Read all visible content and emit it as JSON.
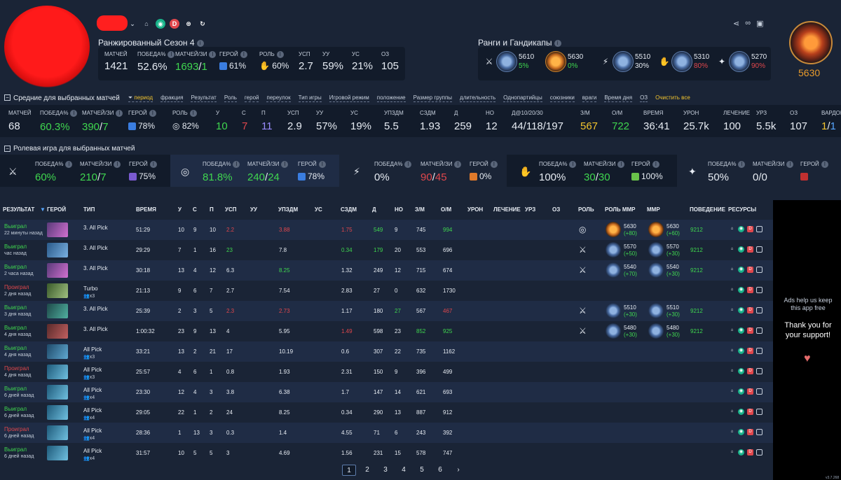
{
  "header": {
    "season_title": "Ранжированный Сезон 4",
    "ranks_title": "Ранги и Гандикапы",
    "big_mmr": "5630",
    "season_stats": [
      {
        "label": "МАТЧЕЙ",
        "value": "1421"
      },
      {
        "label": "ПОБЕДА%",
        "value": "52.6%"
      },
      {
        "label": "МАТЧЕЙ/ЗИ",
        "value_a": "1693",
        "sep": "/",
        "value_b": "1"
      },
      {
        "label": "ГЕРОЙ",
        "value": "61%"
      },
      {
        "label": "РОЛЬ",
        "value": "60%"
      },
      {
        "label": "УСП",
        "value": "2.7"
      },
      {
        "label": "УУ",
        "value": "59%"
      },
      {
        "label": "УС",
        "value": "21%"
      },
      {
        "label": "ОЗ",
        "value": "105"
      }
    ],
    "ranks": [
      {
        "mmr": "5610",
        "pct": "5%",
        "role_icon": "sword-icon",
        "color": "green"
      },
      {
        "mmr": "5630",
        "pct": "0%",
        "role_icon": "none",
        "color": "green"
      },
      {
        "mmr": "5510",
        "pct": "30%",
        "role_icon": "lightning-icon",
        "color": "white"
      },
      {
        "mmr": "5310",
        "pct": "80%",
        "role_icon": "hand-icon",
        "color": "red"
      },
      {
        "mmr": "5270",
        "pct": "90%",
        "role_icon": "support-icon",
        "color": "red"
      }
    ]
  },
  "filters": {
    "section_title": "Средние для выбранных матчей",
    "chips": [
      "период",
      "фракция",
      "Результат",
      "Роль",
      "герой",
      "переулок",
      "Тип игры",
      "Игровой режим",
      "положение",
      "Размер группы",
      "длительность",
      "Однопартийцы",
      "союзники",
      "враги",
      "Время дня",
      "ОЗ"
    ],
    "clear_label": "Очистить все"
  },
  "averages": [
    {
      "label": "МАТЧЕЙ",
      "value": "68"
    },
    {
      "label": "ПОБЕДА%",
      "value": "60.3%"
    },
    {
      "label": "МАТЧЕЙ/ЗИ",
      "value_a": "390",
      "sep": "/",
      "value_b": "7"
    },
    {
      "label": "ГЕРОЙ",
      "value": "78%"
    },
    {
      "label": "РОЛЬ",
      "value": "82%"
    },
    {
      "label": "У",
      "value": "10"
    },
    {
      "label": "С",
      "value": "7"
    },
    {
      "label": "П",
      "value": "11"
    },
    {
      "label": "УСП",
      "value": "2.9"
    },
    {
      "label": "УУ",
      "value": "57%"
    },
    {
      "label": "УС",
      "value": "19%"
    },
    {
      "label": "УПЗДМ",
      "value": "5.5"
    },
    {
      "label": "СЗДМ",
      "value": "1.93"
    },
    {
      "label": "Д",
      "value": "259"
    },
    {
      "label": "НО",
      "value": "12"
    },
    {
      "label": "Д@10/20/30",
      "value": "44/118/197"
    },
    {
      "label": "З/М",
      "value": "567"
    },
    {
      "label": "О/М",
      "value": "722"
    },
    {
      "label": "ВРЕМЯ",
      "value": "36:41"
    },
    {
      "label": "УРОН",
      "value": "25.7k"
    },
    {
      "label": "ЛЕЧЕНИЕ",
      "value": "100"
    },
    {
      "label": "УРЗ",
      "value": "5.5k"
    },
    {
      "label": "ОЗ",
      "value": "107"
    },
    {
      "label": "ВАРДОВ",
      "value_a": "1",
      "sep": "/",
      "value_b": "1"
    }
  ],
  "roles": {
    "title": "Ролевая игра для выбранных матчей",
    "cards": [
      {
        "win": "60%",
        "matches_a": "210",
        "matches_b": "7",
        "hero": "75%"
      },
      {
        "win": "81.8%",
        "matches_a": "240",
        "matches_b": "24",
        "hero": "78%"
      },
      {
        "win": "0%",
        "matches_a": "90",
        "matches_b": "45",
        "hero": "0%"
      },
      {
        "win": "100%",
        "matches_a": "30",
        "matches_b": "30",
        "hero": "100%"
      },
      {
        "win": "50%",
        "matches_a": "0",
        "matches_b": "0",
        "hero": ""
      }
    ],
    "labels": {
      "win": "ПОБЕДА%",
      "matches": "МАТЧЕЙ/ЗИ",
      "hero": "ГЕРОЙ"
    }
  },
  "table": {
    "headers": [
      "РЕЗУЛЬТАТ",
      "ГЕРОЙ",
      "ТИП",
      "ВРЕМЯ",
      "У",
      "С",
      "П",
      "УСП",
      "УУ",
      "УПЗДМ",
      "УС",
      "СЗДМ",
      "Д",
      "НО",
      "З/М",
      "О/М",
      "УРОН",
      "ЛЕЧЕНИЕ",
      "УРЗ",
      "ОЗ",
      "РОЛЬ",
      "РОЛЬ ММР",
      "ММР",
      "ПОВЕДЕНИЕ",
      "РЕСУРСЫ"
    ],
    "rows": [
      {
        "result": "Выиграл",
        "when": "22 минуты назад",
        "type": "3. All Pick",
        "party": "",
        "time": "51:29",
        "k": "10",
        "d": "9",
        "a": "10",
        "kda": "2.2",
        "upzdm": "3.88",
        "szdm": "1.75",
        "lh": "549",
        "dn": "9",
        "gpm": "745",
        "xpm": "994",
        "role": "target",
        "rmmr": "5630",
        "rdelta": "+80",
        "mmr": "5630",
        "mdelta": "+60",
        "behav": "9212",
        "win": true,
        "kda_red": true,
        "upz_red": true,
        "szdm_red": true,
        "lh_green": true,
        "xpm_green": true,
        "dn_green": false,
        "gpm_green": false,
        "xpm_red": false,
        "upz_green": false,
        "szdm_green": false
      },
      {
        "result": "Выиграл",
        "when": "час назад",
        "type": "3. All Pick",
        "party": "",
        "time": "29:29",
        "k": "7",
        "d": "1",
        "a": "16",
        "kda": "23",
        "upzdm": "7.8",
        "szdm": "0.34",
        "lh": "179",
        "dn": "20",
        "gpm": "553",
        "xpm": "696",
        "role": "sword",
        "rmmr": "5570",
        "rdelta": "+50",
        "mmr": "5570",
        "mdelta": "+30",
        "behav": "9212",
        "win": true,
        "kda_green": true,
        "szdm_green": true,
        "lh_green": true
      },
      {
        "result": "Выиграл",
        "when": "2 часа назад",
        "type": "3. All Pick",
        "party": "",
        "time": "30:18",
        "k": "13",
        "d": "4",
        "a": "12",
        "kda": "6.3",
        "upzdm": "8.25",
        "szdm": "1.32",
        "lh": "249",
        "dn": "12",
        "gpm": "715",
        "xpm": "674",
        "role": "sword",
        "rmmr": "5540",
        "rdelta": "+70",
        "mmr": "5540",
        "mdelta": "+30",
        "behav": "9212",
        "win": true,
        "upz_green": true
      },
      {
        "result": "Проиграл",
        "when": "2 дня назад",
        "type": "Turbo",
        "party": "x3",
        "time": "21:13",
        "k": "9",
        "d": "6",
        "a": "7",
        "kda": "2.7",
        "upzdm": "7.54",
        "szdm": "2.83",
        "lh": "27",
        "dn": "0",
        "gpm": "632",
        "xpm": "1730",
        "role": "",
        "rmmr": "",
        "rdelta": "",
        "mmr": "",
        "mdelta": "",
        "behav": "",
        "win": false
      },
      {
        "result": "Выиграл",
        "when": "3 дня назад",
        "type": "3. All Pick",
        "party": "",
        "time": "25:39",
        "k": "2",
        "d": "3",
        "a": "5",
        "kda": "2.3",
        "upzdm": "2.73",
        "szdm": "1.17",
        "lh": "180",
        "dn": "27",
        "gpm": "567",
        "xpm": "467",
        "role": "sword",
        "rmmr": "5510",
        "rdelta": "+30",
        "mmr": "5510",
        "mdelta": "+30",
        "behav": "9212",
        "win": true,
        "kda_red": true,
        "upz_red": true,
        "dn_green": true,
        "xpm_red": true
      },
      {
        "result": "Выиграл",
        "when": "4 дня назад",
        "type": "3. All Pick",
        "party": "",
        "time": "1:00:32",
        "k": "23",
        "d": "9",
        "a": "13",
        "kda": "4",
        "upzdm": "5.95",
        "szdm": "1.49",
        "lh": "598",
        "dn": "23",
        "gpm": "852",
        "xpm": "925",
        "role": "sword",
        "rmmr": "5480",
        "rdelta": "+30",
        "mmr": "5480",
        "mdelta": "+30",
        "behav": "9212",
        "win": true,
        "szdm_red": true,
        "gpm_green": true,
        "xpm_green": true
      },
      {
        "result": "Выиграл",
        "when": "4 дня назад",
        "type": "All Pick",
        "party": "x3",
        "time": "33:21",
        "k": "13",
        "d": "2",
        "a": "21",
        "kda": "17",
        "upzdm": "10.19",
        "szdm": "0.6",
        "lh": "307",
        "dn": "22",
        "gpm": "735",
        "xpm": "1162",
        "role": "",
        "rmmr": "",
        "rdelta": "",
        "mmr": "",
        "mdelta": "",
        "behav": "",
        "win": true
      },
      {
        "result": "Проиграл",
        "when": "4 дня назад",
        "type": "All Pick",
        "party": "x3",
        "time": "25:57",
        "k": "4",
        "d": "6",
        "a": "1",
        "kda": "0.8",
        "upzdm": "1.93",
        "szdm": "2.31",
        "lh": "150",
        "dn": "9",
        "gpm": "396",
        "xpm": "499",
        "role": "",
        "rmmr": "",
        "rdelta": "",
        "mmr": "",
        "mdelta": "",
        "behav": "",
        "win": false
      },
      {
        "result": "Выиграл",
        "when": "6 дней назад",
        "type": "All Pick",
        "party": "x4",
        "time": "23:30",
        "k": "12",
        "d": "4",
        "a": "3",
        "kda": "3.8",
        "upzdm": "6.38",
        "szdm": "1.7",
        "lh": "147",
        "dn": "14",
        "gpm": "621",
        "xpm": "693",
        "role": "",
        "rmmr": "",
        "rdelta": "",
        "mmr": "",
        "mdelta": "",
        "behav": "",
        "win": true
      },
      {
        "result": "Выиграл",
        "when": "6 дней назад",
        "type": "All Pick",
        "party": "x4",
        "time": "29:05",
        "k": "22",
        "d": "1",
        "a": "2",
        "kda": "24",
        "upzdm": "8.25",
        "szdm": "0.34",
        "lh": "290",
        "dn": "13",
        "gpm": "887",
        "xpm": "912",
        "role": "",
        "rmmr": "",
        "rdelta": "",
        "mmr": "",
        "mdelta": "",
        "behav": "",
        "win": true
      },
      {
        "result": "Проиграл",
        "when": "6 дней назад",
        "type": "All Pick",
        "party": "x4",
        "time": "28:36",
        "k": "1",
        "d": "13",
        "a": "3",
        "kda": "0.3",
        "upzdm": "1.4",
        "szdm": "4.55",
        "lh": "71",
        "dn": "6",
        "gpm": "243",
        "xpm": "392",
        "role": "",
        "rmmr": "",
        "rdelta": "",
        "mmr": "",
        "mdelta": "",
        "behav": "",
        "win": false
      },
      {
        "result": "Выиграл",
        "when": "6 дней назад",
        "type": "All Pick",
        "party": "x4",
        "time": "31:57",
        "k": "10",
        "d": "5",
        "a": "5",
        "kda": "3",
        "upzdm": "4.69",
        "szdm": "1.56",
        "lh": "231",
        "dn": "15",
        "gpm": "578",
        "xpm": "747",
        "role": "",
        "rmmr": "",
        "rdelta": "",
        "mmr": "",
        "mdelta": "",
        "behav": "",
        "win": true
      }
    ]
  },
  "pager": {
    "pages": [
      "1",
      "2",
      "3",
      "4",
      "5",
      "6"
    ],
    "next": "›"
  },
  "ad": {
    "small": "Ads help us keep this app free",
    "big": "Thank you for your support!"
  },
  "version": "v3.7.268",
  "colors": {
    "bg": "#1a2436",
    "panel": "#121b2a",
    "green": "#3fd64f",
    "red": "#e0474c",
    "gold": "#f1c32e"
  }
}
